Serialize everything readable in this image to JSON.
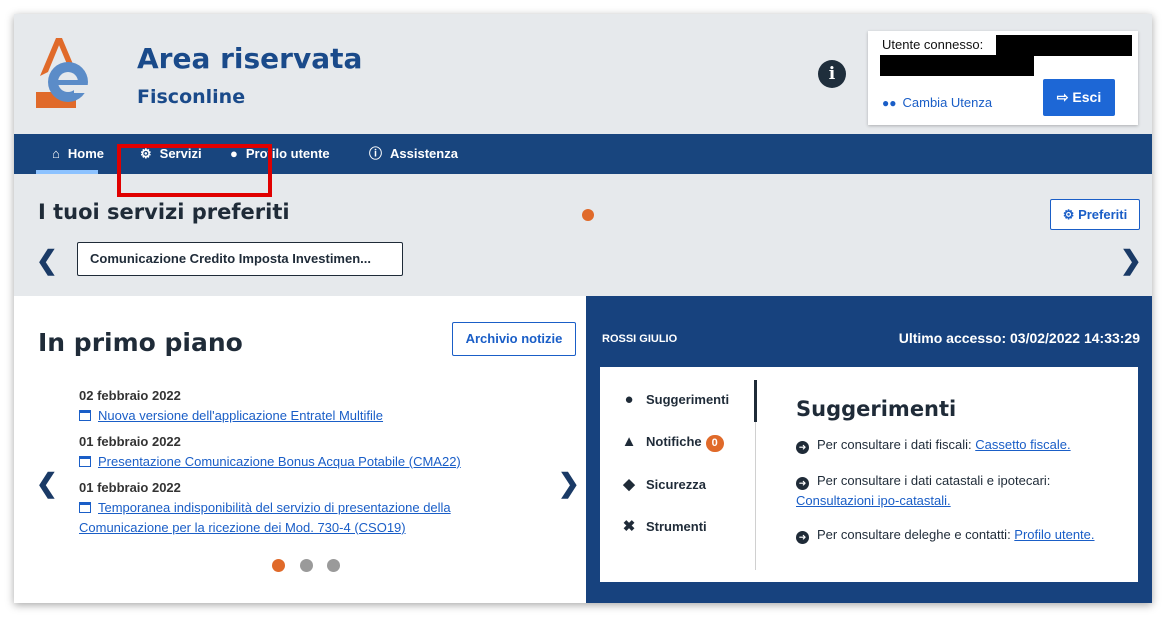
{
  "header": {
    "title": "Area riservata",
    "subtitle": "Fisconline",
    "info_icon": "info-icon",
    "user_label": "Utente connesso:",
    "cambia_label": "Cambia Utenza",
    "esci_label": "Esci"
  },
  "nav": {
    "items": [
      {
        "label": "Home",
        "icon": "home-icon"
      },
      {
        "label": "Servizi",
        "icon": "services-icon"
      },
      {
        "label": "Profilo utente",
        "icon": "user-icon"
      },
      {
        "label": "Assistenza",
        "icon": "info-icon"
      }
    ]
  },
  "favorites": {
    "title": "I tuoi servizi preferiti",
    "button_label": "Preferiti",
    "card_label": "Comunicazione Credito Imposta Investimen..."
  },
  "news": {
    "title": "In primo piano",
    "archive_label": "Archivio notizie",
    "items": [
      {
        "date": "02 febbraio 2022",
        "link": "Nuova versione dell'applicazione Entratel Multifile"
      },
      {
        "date": "01 febbraio 2022",
        "link": "Presentazione Comunicazione Bonus Acqua Potabile (CMA22)"
      },
      {
        "date": "01 febbraio 2022",
        "link": "Temporanea indisponibilità del servizio di presentazione della Comunicazione per la ricezione dei Mod. 730-4 (CSO19)"
      }
    ],
    "active_page": 1,
    "page_count": 3
  },
  "panel": {
    "user_name": "ROSSI GIULIO",
    "last_access": "Ultimo accesso: 03/02/2022 14:33:29",
    "menu": [
      {
        "label": "Suggerimenti",
        "icon": "lightbulb-icon"
      },
      {
        "label": "Notifiche",
        "icon": "bell-icon",
        "badge": "0"
      },
      {
        "label": "Sicurezza",
        "icon": "shield-icon"
      },
      {
        "label": "Strumenti",
        "icon": "tools-icon"
      }
    ],
    "suggestions_title": "Suggerimenti",
    "suggestions": [
      {
        "text": "Per consultare i dati fiscali: ",
        "link": "Cassetto fiscale."
      },
      {
        "text": "Per consultare i dati catastali e ipotecari: ",
        "link": "Consultazioni ipo-catastali."
      },
      {
        "text": "Per consultare deleghe e contatti: ",
        "link": "Profilo utente."
      }
    ]
  },
  "colors": {
    "primary": "#18457e",
    "accent": "#e06a2a",
    "link": "#1a5ec7",
    "highlight": "#e00000"
  }
}
